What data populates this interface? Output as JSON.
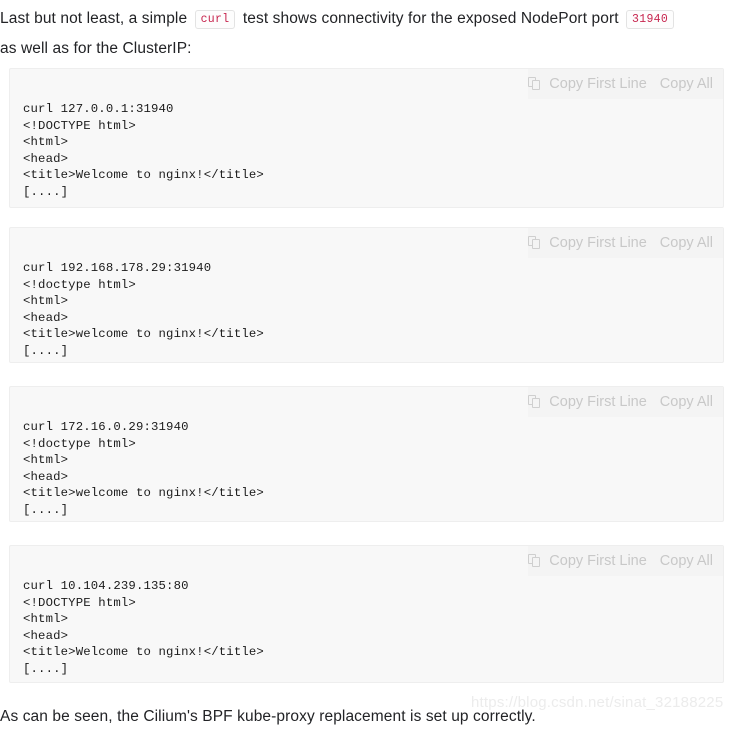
{
  "intro": {
    "part1": "Last but not least, a simple",
    "code1": "curl",
    "part2": "test shows connectivity for the exposed NodePort port",
    "code2": "31940",
    "part3": "as well as for the ClusterIP:"
  },
  "closing": {
    "text": "As can be seen, the Cilium's BPF kube-proxy replacement is set up correctly."
  },
  "toolbar": {
    "copy_first_line_label": "Copy First Line",
    "copy_all_label": "Copy All",
    "copy_icon": "copy-icon"
  },
  "code_blocks": [
    {
      "id": "nodeport-loopback",
      "command": "curl 127.0.0.1:31940",
      "content": "curl 127.0.0.1:31940\n<!DOCTYPE html>\n<html>\n<head>\n<title>Welcome to nginx!</title>\n[....]"
    },
    {
      "id": "nodeport-node-ip",
      "command": "curl 192.168.178.29:31940",
      "content": "curl 192.168.178.29:31940\n<!doctype html>\n<html>\n<head>\n<title>welcome to nginx!</title>\n[....]"
    },
    {
      "id": "nodeport-pod-cidr-ip",
      "command": "curl 172.16.0.29:31940",
      "content": "curl 172.16.0.29:31940\n<!doctype html>\n<html>\n<head>\n<title>welcome to nginx!</title>\n[....]"
    },
    {
      "id": "clusterip",
      "command": "curl 10.104.239.135:80",
      "content": "curl 10.104.239.135:80\n<!DOCTYPE html>\n<html>\n<head>\n<title>Welcome to nginx!</title>\n[....]"
    }
  ],
  "watermark": {
    "text": "https://blog.csdn.net/sinat_32188225"
  },
  "colors": {
    "inline_code_text": "#c7254e",
    "code_block_bg": "#f8f8f8",
    "toolbar_text": "#c8c8c8",
    "body_text": "#222326"
  }
}
